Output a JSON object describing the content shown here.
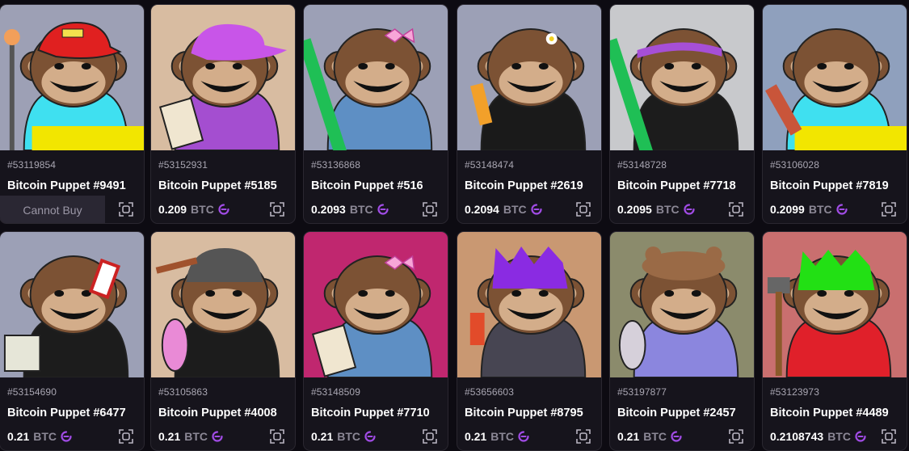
{
  "cards": [
    {
      "inscription": "#53119854",
      "title": "Bitcoin Puppet #9491",
      "price": "",
      "unit": "",
      "cannot_buy": "Cannot Buy",
      "bg": "#9da0b5",
      "hat": "cap-red",
      "shirt": "#3fe0f0",
      "shirt2": "#f2e600",
      "prop": "torch"
    },
    {
      "inscription": "#53152931",
      "title": "Bitcoin Puppet #5185",
      "price": "0.209",
      "unit": "BTC",
      "bg": "#d8bca1",
      "hat": "cap-purple",
      "shirt": "#a44ed0",
      "prop": "sign"
    },
    {
      "inscription": "#53136868",
      "title": "Bitcoin Puppet #516",
      "price": "0.2093",
      "unit": "BTC",
      "bg": "#9ca0b6",
      "hat": "bow",
      "shirt": "#5e8fc4",
      "prop": "green-stick"
    },
    {
      "inscription": "#53148474",
      "title": "Bitcoin Puppet #2619",
      "price": "0.2094",
      "unit": "BTC",
      "bg": "#9ca0b6",
      "hat": "flower",
      "shirt": "#1a1a1a",
      "prop": "bottle"
    },
    {
      "inscription": "#53148728",
      "title": "Bitcoin Puppet #7718",
      "price": "0.2095",
      "unit": "BTC",
      "bg": "#c8c9cc",
      "hat": "headband",
      "shirt": "#1c1c1c",
      "prop": "green-stick"
    },
    {
      "inscription": "#53106028",
      "title": "Bitcoin Puppet #7819",
      "price": "0.2099",
      "unit": "BTC",
      "bg": "#8fa0bd",
      "hat": "none",
      "shirt": "#3fe0f0",
      "shirt2": "#f2e600",
      "prop": "hotdog"
    },
    {
      "inscription": "#53154690",
      "title": "Bitcoin Puppet #6477",
      "price": "0.21",
      "unit": "BTC",
      "bg": "#9ca0b6",
      "hat": "striped",
      "shirt": "#1c1c1c",
      "prop": "bag"
    },
    {
      "inscription": "#53105863",
      "title": "Bitcoin Puppet #4008",
      "price": "0.21",
      "unit": "BTC",
      "bg": "#d8bca1",
      "hat": "beanie",
      "shirt": "#1c1c1c",
      "prop": "pink"
    },
    {
      "inscription": "#53148509",
      "title": "Bitcoin Puppet #7710",
      "price": "0.21",
      "unit": "BTC",
      "bg": "#c0276f",
      "hat": "bow",
      "shirt": "#5e8fc4",
      "prop": "sign"
    },
    {
      "inscription": "#53656603",
      "title": "Bitcoin Puppet #8795",
      "price": "0.21",
      "unit": "BTC",
      "bg": "#c99872",
      "hat": "crown-purple",
      "shirt": "#474552",
      "prop": "toy"
    },
    {
      "inscription": "#53197877",
      "title": "Bitcoin Puppet #2457",
      "price": "0.21",
      "unit": "BTC",
      "bg": "#8b8b6c",
      "hat": "bear",
      "shirt": "#8b86de",
      "prop": "rabbit"
    },
    {
      "inscription": "#53123973",
      "title": "Bitcoin Puppet #4489",
      "price": "0.2108743",
      "unit": "BTC",
      "bg": "#c96f6f",
      "hat": "crown-green",
      "shirt": "#e0202a",
      "prop": "hammer"
    }
  ],
  "chain_icon_color": "#a14ce6"
}
